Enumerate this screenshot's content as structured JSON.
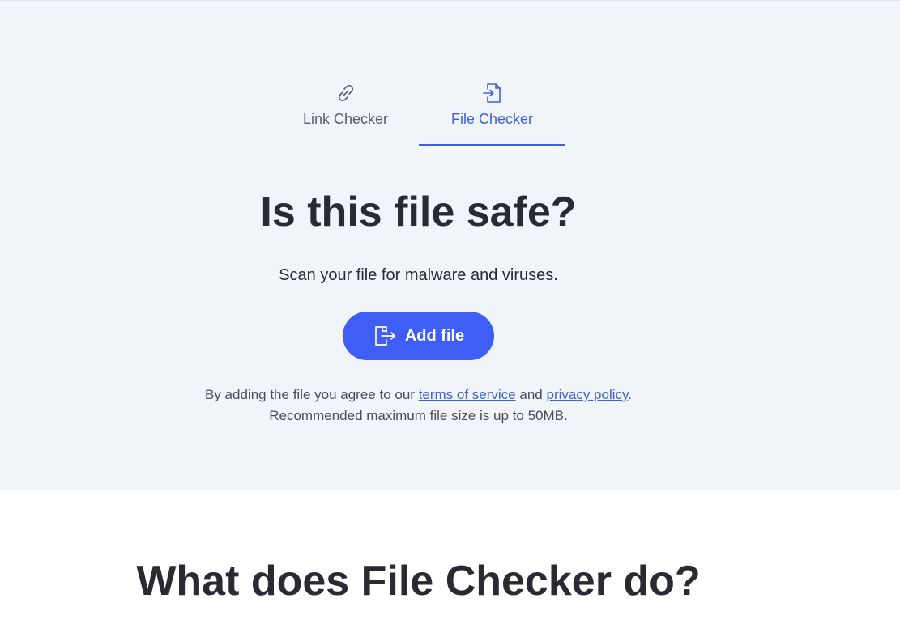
{
  "tabs": [
    {
      "label": "Link Checker",
      "icon": "link-icon",
      "active": false
    },
    {
      "label": "File Checker",
      "icon": "file-import-icon",
      "active": true
    }
  ],
  "hero": {
    "title": "Is this file safe?",
    "subtitle": "Scan your file for malware and viruses.",
    "add_button_label": "Add file",
    "add_button_icon": "file-export-icon"
  },
  "legal": {
    "prefix": "By adding the file you agree to our ",
    "terms_link": "terms of service",
    "middle": " and ",
    "privacy_link": "privacy policy",
    "suffix": ".",
    "size_note": "Recommended maximum file size is up to 50MB."
  },
  "section": {
    "title": "What does File Checker do?"
  },
  "colors": {
    "accent": "#3e5ef5",
    "active_tab": "#3b63d6",
    "hero_bg": "#f1f4f9",
    "text": "#2a2b32"
  }
}
